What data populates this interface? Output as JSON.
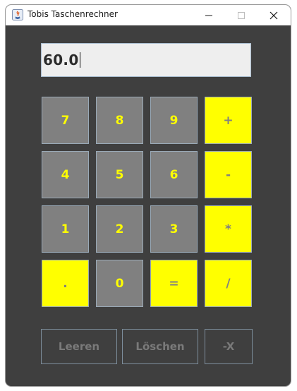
{
  "window": {
    "title": "Tobis Taschenrechner",
    "icons": [
      "java-app-icon",
      "minimize-icon",
      "maximize-icon",
      "close-icon"
    ]
  },
  "display": {
    "value": "60.0"
  },
  "keypad": {
    "rows": [
      [
        "7",
        "8",
        "9",
        "+"
      ],
      [
        "4",
        "5",
        "6",
        "-"
      ],
      [
        "1",
        "2",
        "3",
        "*"
      ],
      [
        ".",
        "0",
        "=",
        "/"
      ]
    ]
  },
  "actions": {
    "clear": "Leeren",
    "delete": "Löschen",
    "negate": "-X"
  },
  "colors": {
    "panel": "#3f3f3f",
    "key_grey": "#808080",
    "key_yellow": "#ffff00",
    "display_bg": "#eeeeee",
    "action_text": "#7a7a7a"
  }
}
